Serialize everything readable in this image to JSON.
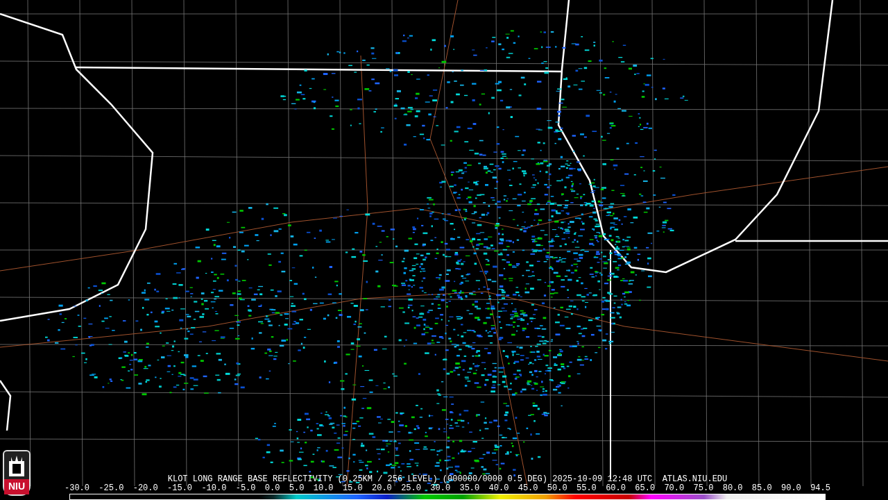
{
  "title": "KLOT LONG RANGE BASE REFLECTIVITY (0.25KM / 256 LEVEL) (000000/0000 0.5 DEG) 2025-10-09 12:48 UTC  ATLAS.NIU.EDU",
  "scale": {
    "ticks": [
      "-30.0",
      "-25.0",
      "-20.0",
      "-15.0",
      "-10.0",
      "-5.0",
      "0.0",
      "5.0",
      "10.0",
      "15.0",
      "20.0",
      "25.0",
      "30.0",
      "35.0",
      "40.0",
      "45.0",
      "50.0",
      "55.0",
      "60.0",
      "65.0",
      "70.0",
      "75.0",
      "80.0",
      "85.0",
      "90.0",
      "94.5"
    ]
  },
  "logo": {
    "text": "NIU"
  }
}
